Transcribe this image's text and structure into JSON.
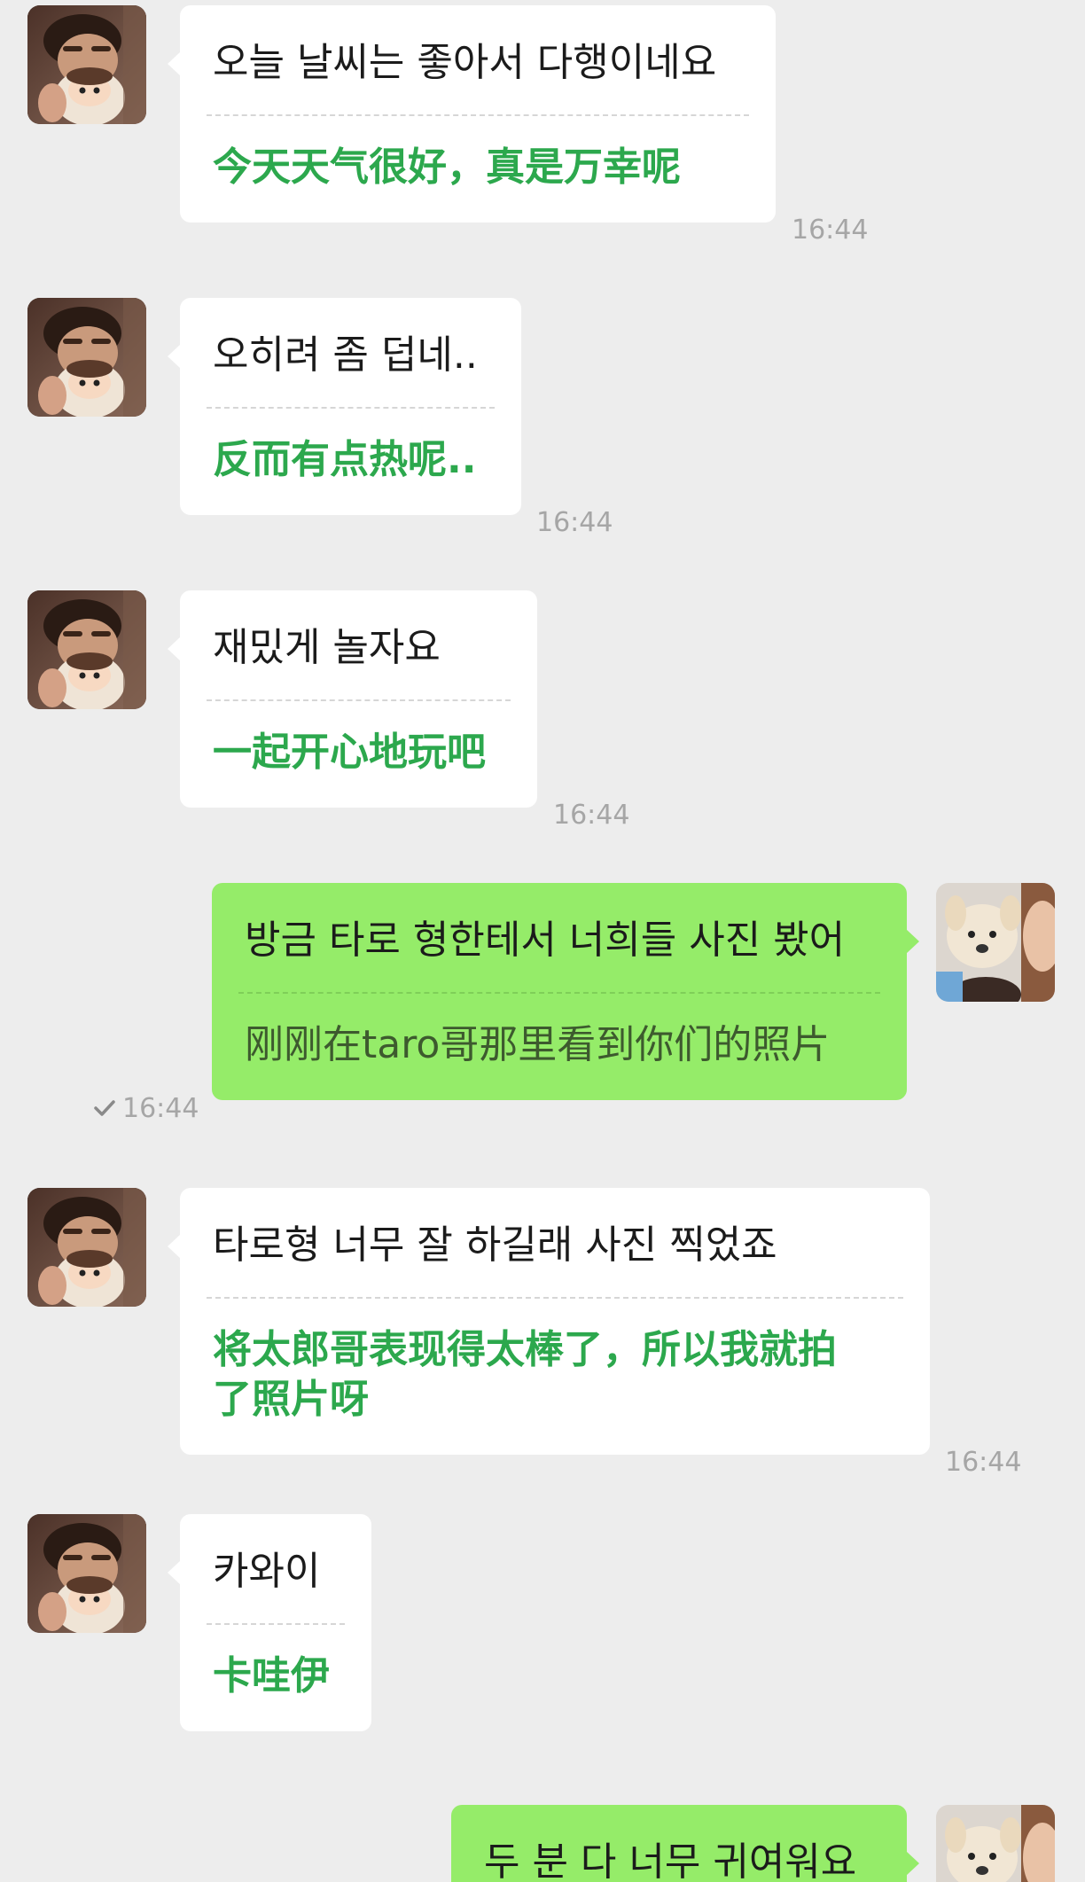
{
  "messages": [
    {
      "side": "in",
      "original": "오늘 날씨는 좋아서 다행이네요",
      "translation": "今天天气很好，真是万幸呢",
      "time": "16:44"
    },
    {
      "side": "in",
      "original": "오히려 좀 덥네..",
      "translation": "反而有点热呢..",
      "time": "16:44"
    },
    {
      "side": "in",
      "original": "재밌게 놀자요",
      "translation": "一起开心地玩吧",
      "time": "16:44"
    },
    {
      "side": "out",
      "original": "방금 타로 형한테서 너희들 사진 봤어",
      "translation": "刚刚在taro哥那里看到你们的照片",
      "time": "16:44",
      "read": true
    },
    {
      "side": "in",
      "original": "타로형 너무 잘 하길래 사진 찍었죠",
      "translation_line1": "将太郎哥表现得太棒了，所以我就拍",
      "translation_line2": "了照片呀",
      "time": "16:44"
    },
    {
      "side": "in",
      "original": "카와이",
      "translation": "卡哇伊"
    },
    {
      "side": "out",
      "original": "두 분 다 너무 귀여워요"
    }
  ],
  "colors": {
    "background": "#ededed",
    "incoming_bubble": "#ffffff",
    "outgoing_bubble": "#95ec69",
    "translation_green": "#2ca84d",
    "timestamp": "#a6a6a6"
  },
  "icons": {
    "read_receipt": "checkmark-icon",
    "contact_avatar": "avatar-photo-boy-with-plush",
    "self_avatar": "avatar-photo-plush-dog"
  }
}
